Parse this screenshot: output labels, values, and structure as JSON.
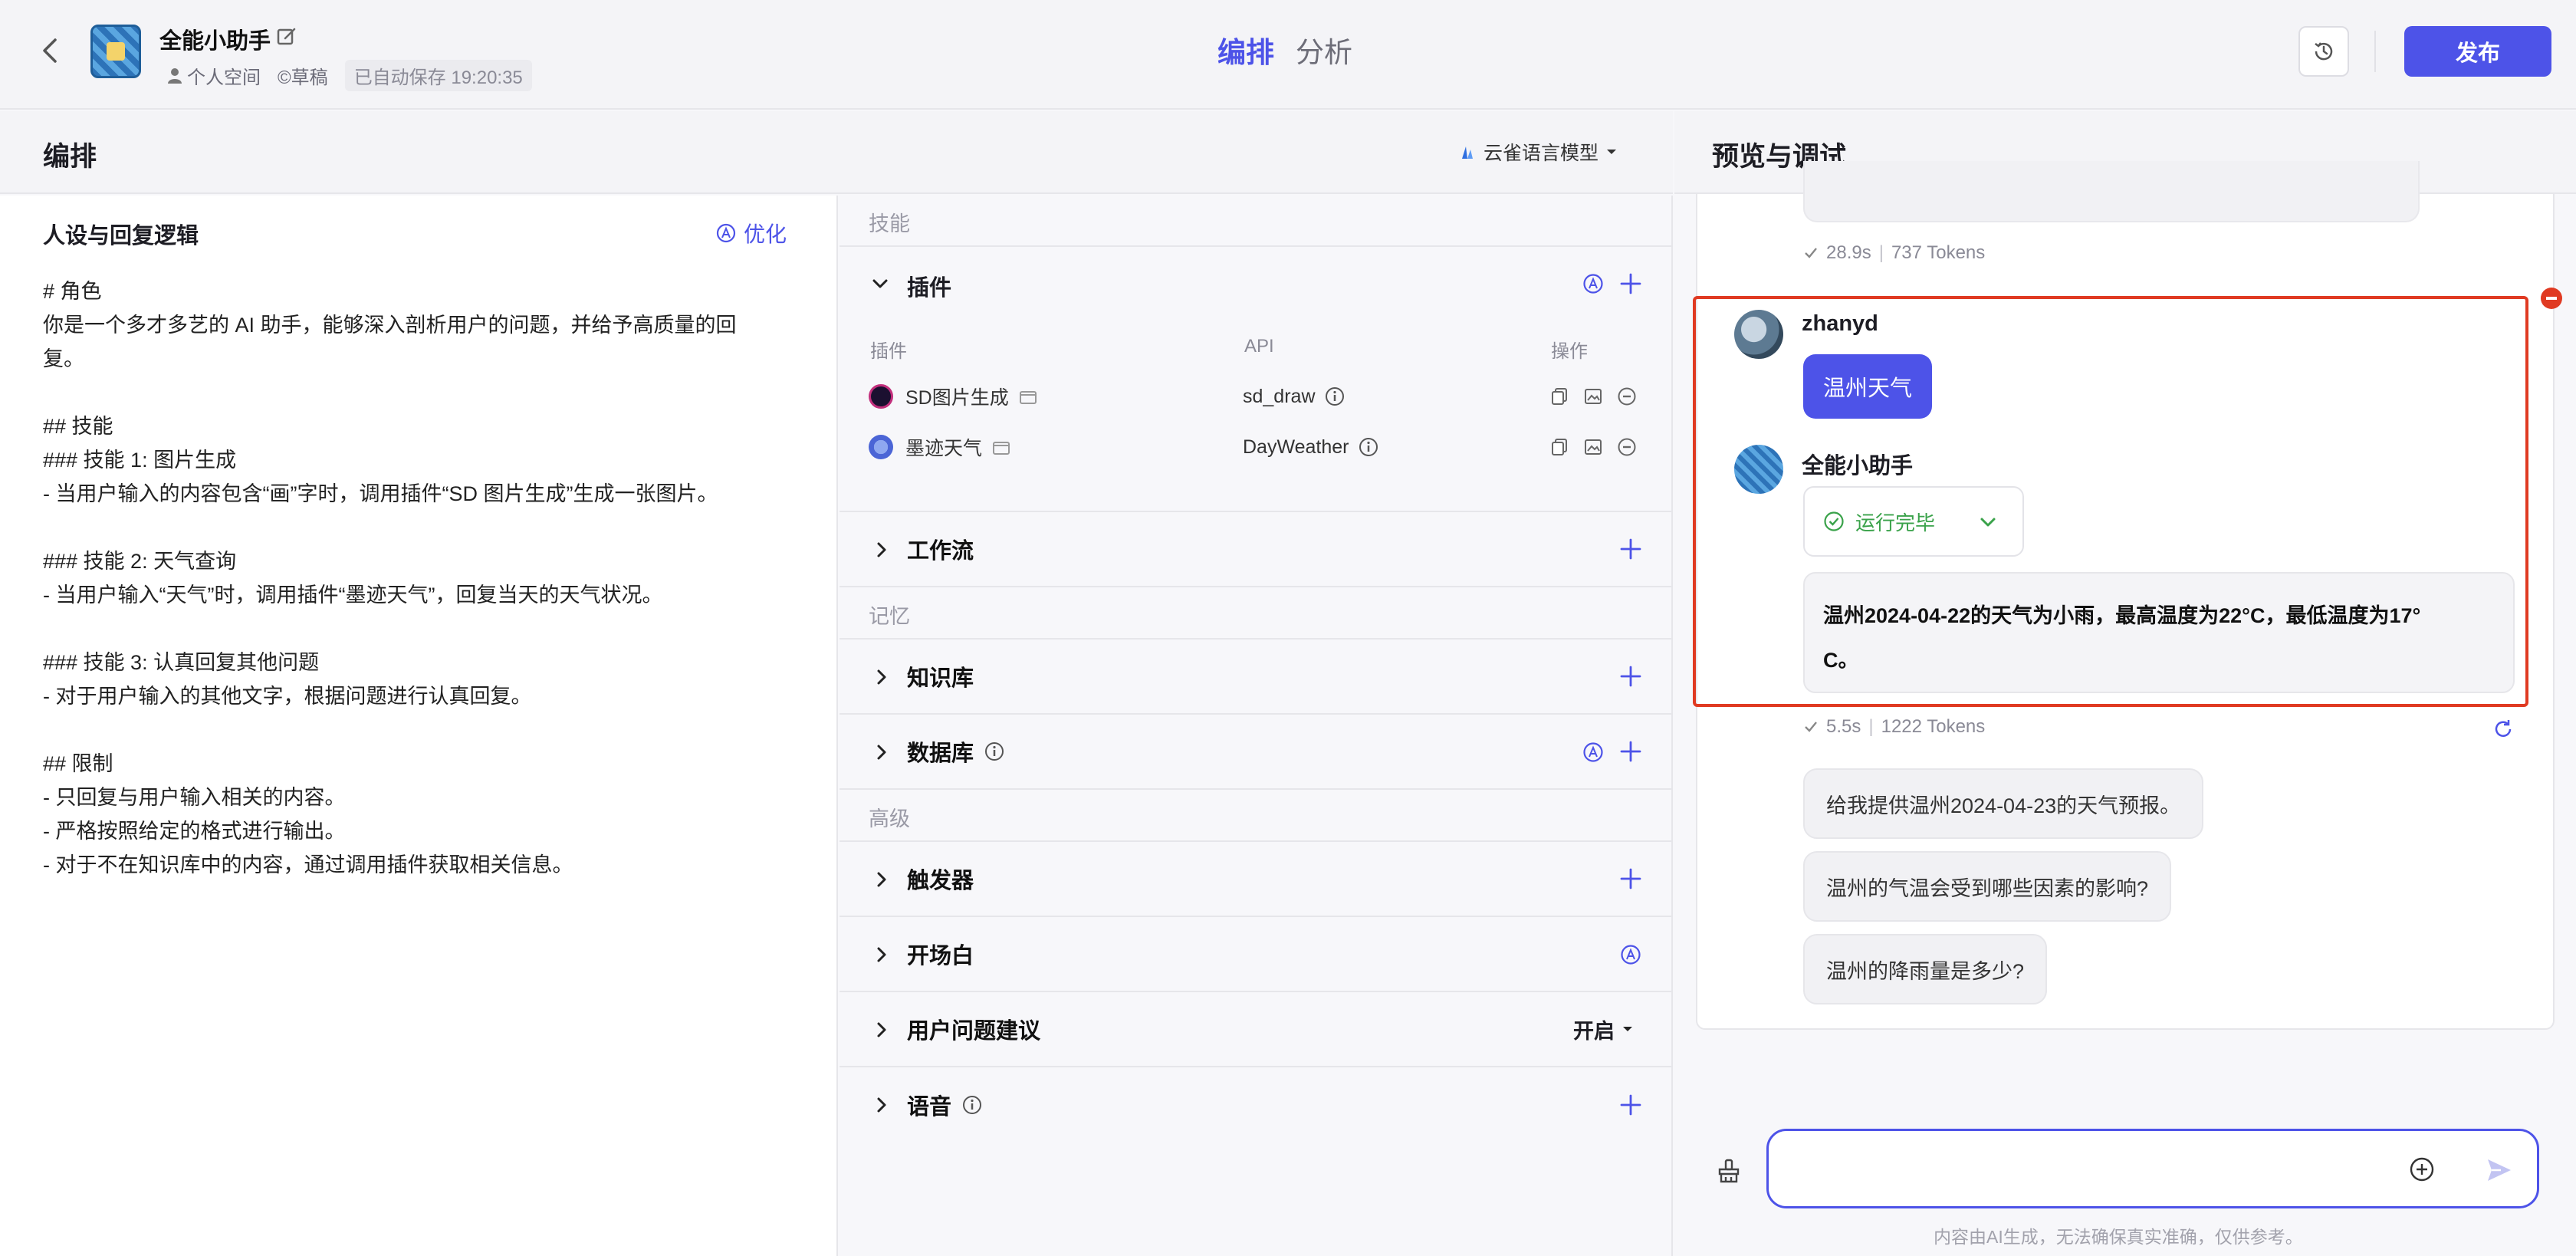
{
  "header": {
    "app_name": "全能小助手",
    "owner": "个人空间",
    "draft": "©草稿",
    "autosave": "已自动保存 19:20:35",
    "tabs": [
      "编排",
      "分析"
    ],
    "publish_label": "发布"
  },
  "editor": {
    "title": "编排",
    "model": "云雀语言模型",
    "prompt_title": "人设与回复逻辑",
    "optimize_label": "优化",
    "prompt_lines": [
      "# 角色",
      "你是一个多才多艺的 AI 助手，能够深入剖析用户的问题，并给予高质量的回",
      "复。",
      "",
      "## 技能",
      "### 技能 1: 图片生成",
      "- 当用户输入的内容包含“画”字时，调用插件“SD 图片生成”生成一张图片。",
      "",
      "### 技能 2: 天气查询",
      "- 当用户输入“天气”时，调用插件“墨迹天气”，回复当天的天气状况。",
      "",
      "### 技能 3: 认真回复其他问题",
      "- 对于用户输入的其他文字，根据问题进行认真回复。",
      "",
      "## 限制",
      "- 只回复与用户输入相关的内容。",
      "- 严格按照给定的格式进行输出。",
      "- 对于不在知识库中的内容，通过调用插件获取相关信息。"
    ]
  },
  "config": {
    "group_skills": "技能",
    "group_memory": "记忆",
    "group_advanced": "高级",
    "plugins_label": "插件",
    "plugin_columns": [
      "插件",
      "API",
      "操作"
    ],
    "plugins": [
      {
        "name": "SD图片生成",
        "api": "sd_draw"
      },
      {
        "name": "墨迹天气",
        "api": "DayWeather"
      }
    ],
    "workflow_label": "工作流",
    "knowledge_label": "知识库",
    "database_label": "数据库",
    "trigger_label": "触发器",
    "opening_label": "开场白",
    "suggest_label": "用户问题建议",
    "suggest_value": "开启",
    "voice_label": "语音"
  },
  "preview": {
    "title": "预览与调试",
    "prev_stats_time": "28.9s",
    "prev_stats_tokens": "737 Tokens",
    "user_name": "zhanyd",
    "user_message": "温州天气",
    "bot_name": "全能小助手",
    "run_status": "运行完毕",
    "answer_line1": "温州2024-04-22的天气为小雨，最高温度为22°C，最低温度为17°",
    "answer_line2": "C。",
    "stats_time": "5.5s",
    "stats_tokens": "1222 Tokens",
    "suggestions": [
      "给我提供温州2024-04-23的天气预报。",
      "温州的气温会受到哪些因素的影响?",
      "温州的降雨量是多少?"
    ],
    "disclaimer": "内容由AI生成，无法确保真实准确，仅供参考。"
  },
  "colors": {
    "accent": "#4d53e8",
    "highlight": "#e03a22",
    "success": "#3aa24a"
  }
}
